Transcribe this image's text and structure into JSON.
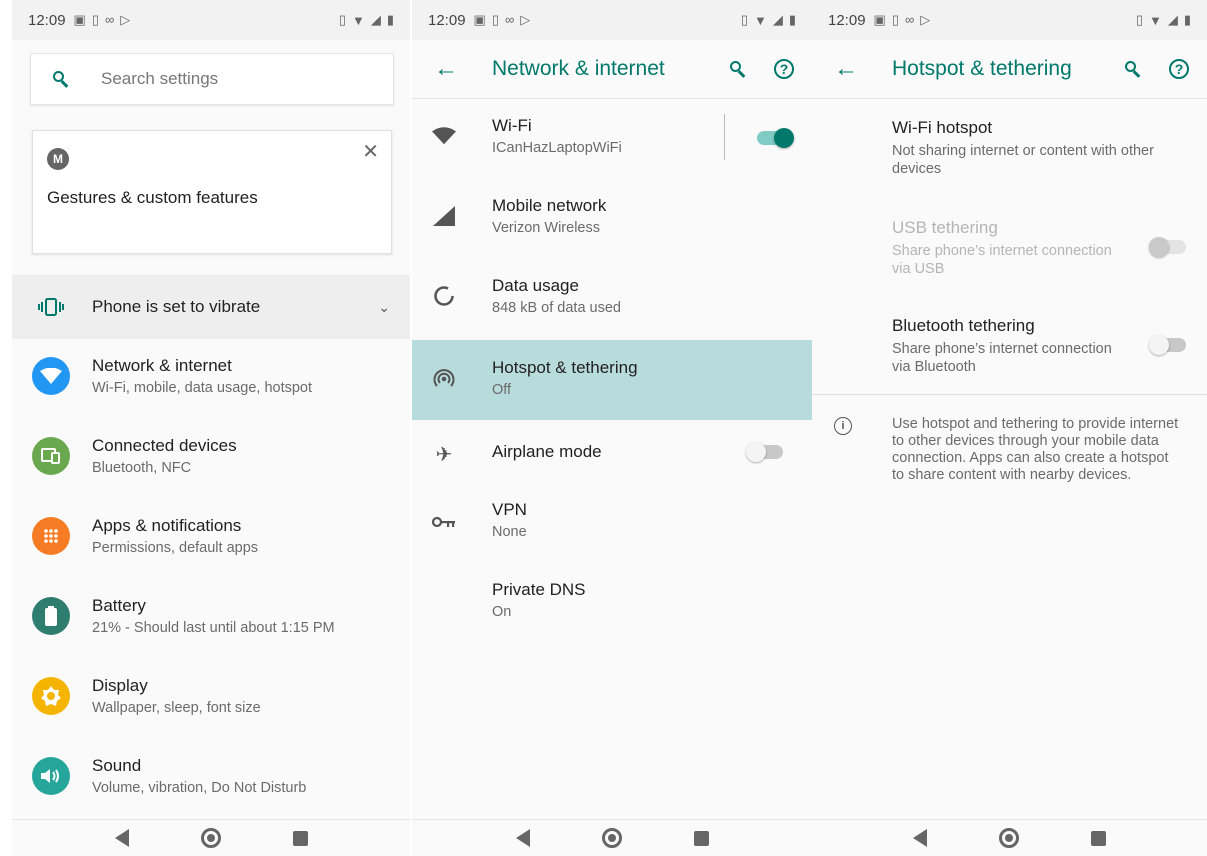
{
  "status_bar": {
    "time": "12:09"
  },
  "panel1": {
    "search": {
      "placeholder": "Search settings"
    },
    "suggestion_card": {
      "title": "Gestures & custom features"
    },
    "vibrate_row": {
      "label": "Phone is set to vibrate"
    },
    "items": [
      {
        "title": "Network & internet",
        "subtitle": "Wi-Fi, mobile, data usage, hotspot",
        "color": "#2196f3",
        "icon": "wifi-icon"
      },
      {
        "title": "Connected devices",
        "subtitle": "Bluetooth, NFC",
        "color": "#6aa84f",
        "icon": "devices-icon"
      },
      {
        "title": "Apps & notifications",
        "subtitle": "Permissions, default apps",
        "color": "#f57c24",
        "icon": "apps-icon"
      },
      {
        "title": "Battery",
        "subtitle": "21% - Should last until about 1:15 PM",
        "color": "#2e7d6f",
        "icon": "battery-icon"
      },
      {
        "title": "Display",
        "subtitle": "Wallpaper, sleep, font size",
        "color": "#f4b400",
        "icon": "brightness-icon"
      },
      {
        "title": "Sound",
        "subtitle": "Volume, vibration, Do Not Disturb",
        "color": "#26a69a",
        "icon": "volume-icon"
      }
    ]
  },
  "panel2": {
    "title": "Network & internet",
    "items": [
      {
        "title": "Wi-Fi",
        "subtitle": "ICanHazLaptopWiFi",
        "toggle": "on"
      },
      {
        "title": "Mobile network",
        "subtitle": "Verizon Wireless"
      },
      {
        "title": "Data usage",
        "subtitle": "848 kB of data used"
      },
      {
        "title": "Hotspot & tethering",
        "subtitle": "Off",
        "selected": true
      },
      {
        "title": "Airplane mode",
        "subtitle": "",
        "toggle": "off"
      },
      {
        "title": "VPN",
        "subtitle": "None"
      },
      {
        "title": "Private DNS",
        "subtitle": "On"
      }
    ]
  },
  "panel3": {
    "title": "Hotspot & tethering",
    "items": [
      {
        "title": "Wi-Fi hotspot",
        "subtitle": "Not sharing internet or content with other devices"
      },
      {
        "title": "USB tethering",
        "subtitle": "Share phone’s internet connection via USB",
        "toggle": "disabled"
      },
      {
        "title": "Bluetooth tethering",
        "subtitle": "Share phone’s internet connection via Bluetooth",
        "toggle": "off"
      }
    ],
    "info": "Use hotspot and tethering to provide internet to other devices through your mobile data connection. Apps can also create a hotspot to share content with nearby devices."
  },
  "colors": {
    "accent": "#00796b",
    "selected_bg": "#b8dcdb"
  }
}
